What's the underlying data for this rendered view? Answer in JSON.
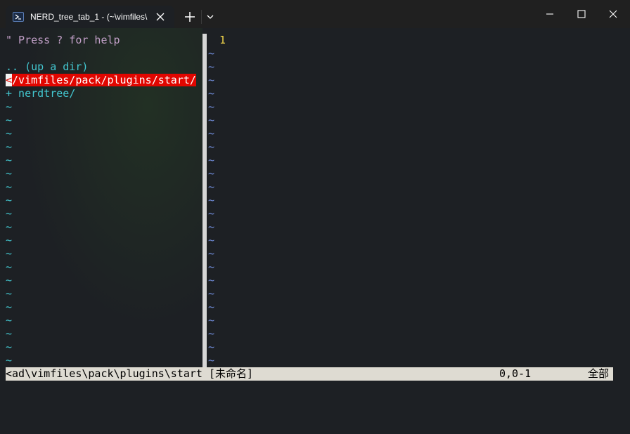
{
  "tab": {
    "title": "NERD_tree_tab_1 - (~\\vimfiles\\",
    "icon": "powershell-icon"
  },
  "toolbar": {
    "new_tab_icon": "plus-icon",
    "dropdown_icon": "chevron-down-icon"
  },
  "window_controls": [
    "minimize-icon",
    "maximize-icon",
    "close-icon"
  ],
  "nerdtree": {
    "help_line": "\" Press ? for help",
    "up_dir": ".. (up a dir)",
    "current_dir_cursor": "<",
    "current_dir_rest": "/vimfiles/pack/plugins/start/",
    "entries": [
      "+ nerdtree/"
    ],
    "filler": "~"
  },
  "editor": {
    "line_number": "1",
    "filler": "~"
  },
  "statusline": {
    "path": "<ad\\vimfiles\\pack\\plugins\\start [未命名]",
    "position": "0,0-1",
    "scroll": "全部"
  },
  "colors": {
    "help": "#c2a0c8",
    "directory": "#43c6cf",
    "selection_bg": "#e10600",
    "line_number": "#f0d44a",
    "tilde_right": "#6f8bd8",
    "statusline_bg": "#dedbd2"
  }
}
